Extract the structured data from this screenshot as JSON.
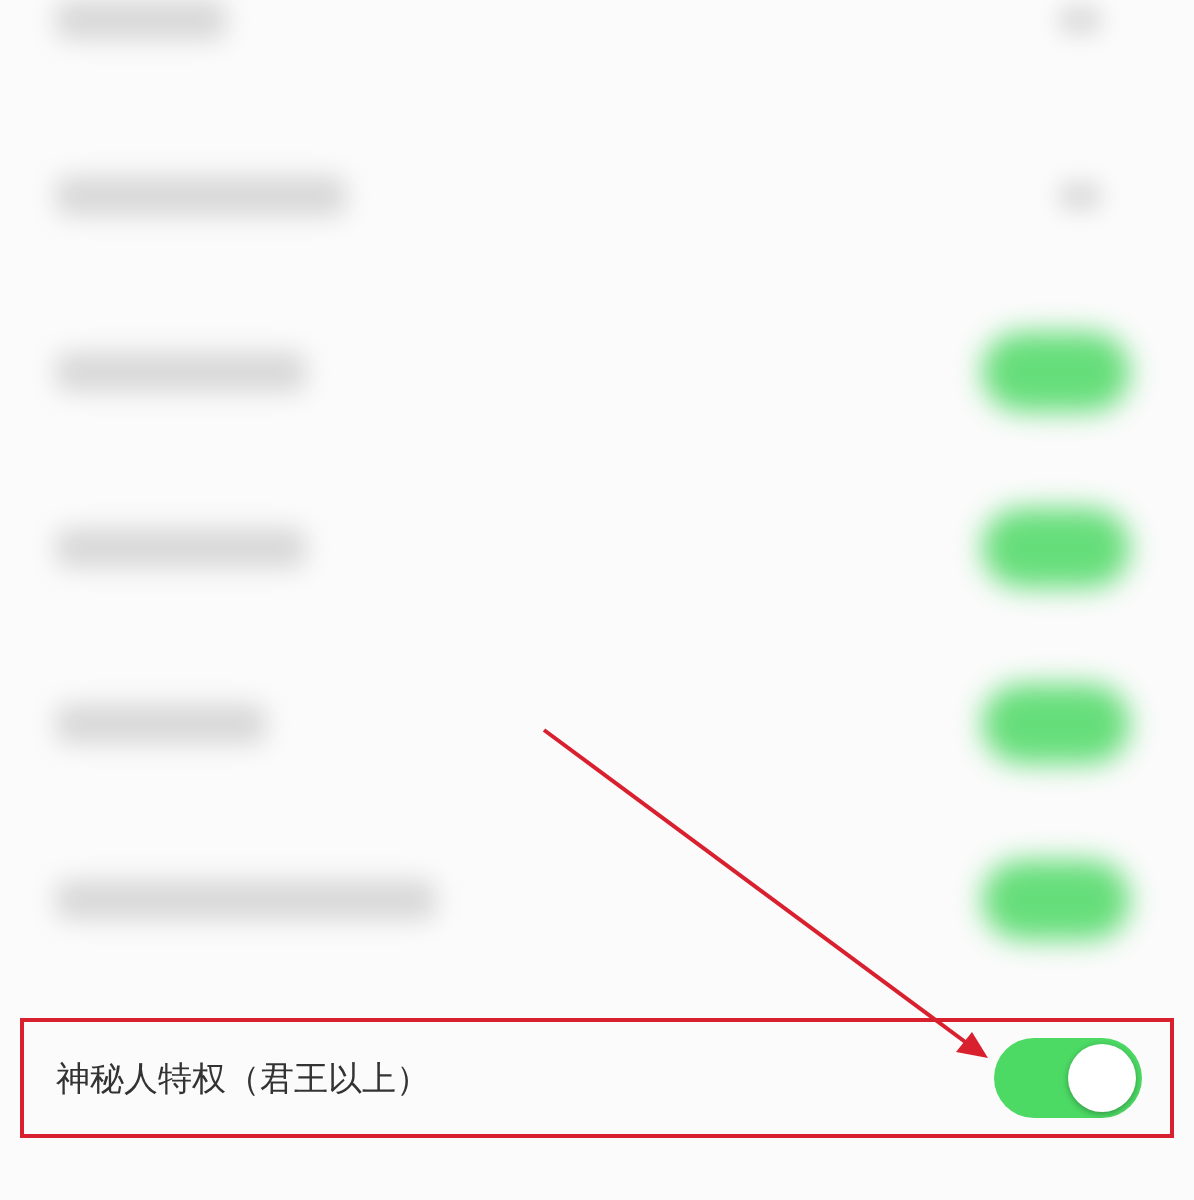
{
  "rows": [
    {
      "kind": "blurred-chevron",
      "highlighted": false
    },
    {
      "kind": "blurred-chevron",
      "highlighted": false
    },
    {
      "kind": "blurred-toggle",
      "on": true,
      "highlighted": false
    },
    {
      "kind": "blurred-toggle",
      "on": true,
      "highlighted": false
    },
    {
      "kind": "blurred-toggle",
      "on": true,
      "highlighted": false
    },
    {
      "kind": "blurred-toggle",
      "on": true,
      "highlighted": false
    },
    {
      "kind": "toggle",
      "label": "神秘人特权（君王以上）",
      "on": true,
      "highlighted": true
    }
  ],
  "annotation": {
    "kind": "arrow"
  }
}
